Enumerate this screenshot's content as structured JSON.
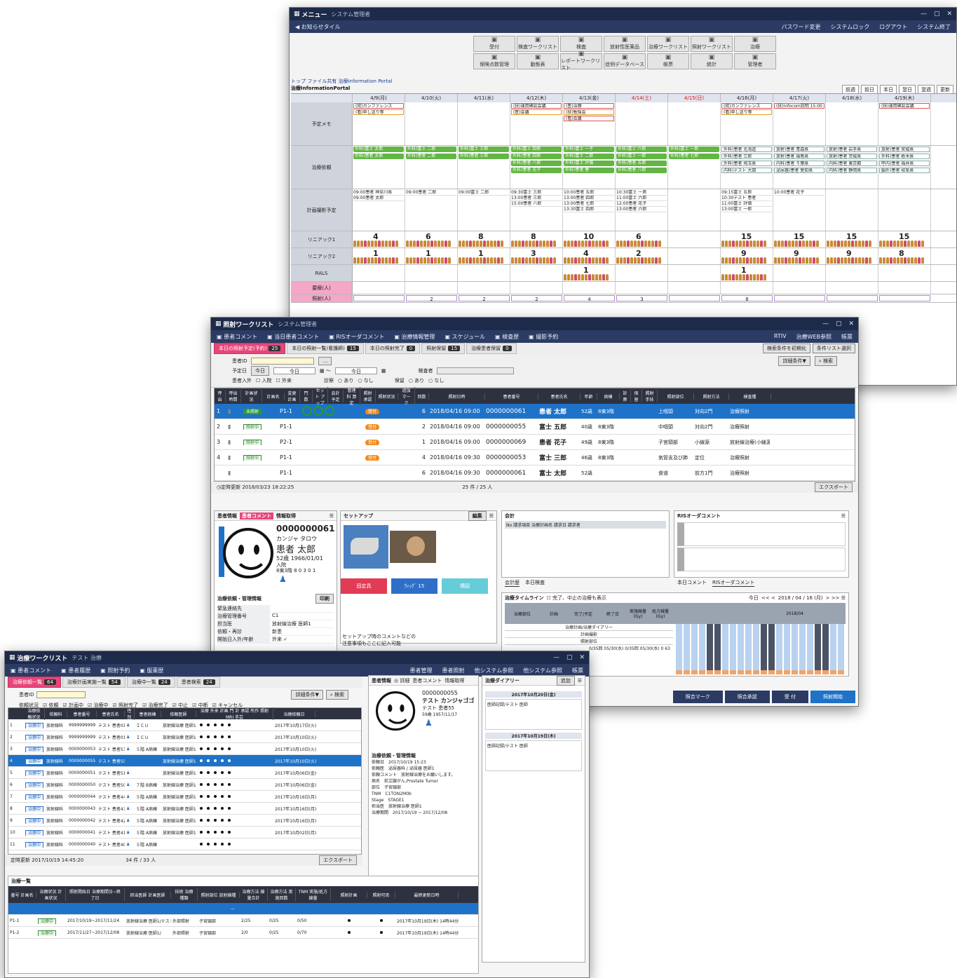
{
  "menu_window": {
    "title": "メニュー",
    "subtitle": "システム管理者",
    "toolbar_left": "お知らせタイル",
    "toolbar_right": [
      "パスワード変更",
      "システムロック",
      "ログアウト",
      "システム終了"
    ],
    "buttons_row1": [
      "受付",
      "検査ワークリスト",
      "検査",
      "放射性医薬品",
      "治療ワークリスト",
      "照射ワークリスト",
      "治療"
    ],
    "buttons_row2": [
      "保険点数管理",
      "動態表",
      "レポートワークリスト",
      "症例データベース",
      "帳票",
      "統計",
      "管理者"
    ],
    "breadcrumb": "トップ ファイル共有 治療Information Portal",
    "portal_title": "治療InformationPortal",
    "nav_buttons": [
      "前週",
      "前日",
      "本日",
      "翌日",
      "翌週",
      "更新"
    ],
    "dates": [
      "4/9(月)",
      "4/10(火)",
      "4/11(水)",
      "4/12(木)",
      "4/13(金)",
      "4/14(土)",
      "4/15(日)",
      "4/16(月)",
      "4/17(火)",
      "4/18(水)",
      "4/19(木)"
    ],
    "row_labels": {
      "memo": "予定メモ",
      "request": "治療依頼",
      "plan": "計画撮影予定",
      "linac1": "リニアック1",
      "linac2": "リニアック2",
      "rals": "RALS",
      "group": "照射人数 合計(外・入)",
      "red": "要療(人)",
      "pink": "照射(人)"
    },
    "memo_cells": [
      [
        "(院)カンファレンス",
        "(看)申し送り等"
      ],
      [],
      [],
      [
        "(技)運用確認会議",
        "(医)会議"
      ],
      [
        "(医)治療",
        "(技)勉強会",
        "(看)会議"
      ],
      [],
      [],
      [
        "(院)カンファレンス",
        "(看)申し送り等"
      ],
      [
        "(技)infocom説明 15:00"
      ],
      [],
      [
        "(技)運用確認会議"
      ]
    ],
    "request_cells": [
      [
        "外科)富士 太郎",
        "外科)患者 太郎"
      ],
      [
        "外科)富士 二郎",
        "外科)患者 二郎"
      ],
      [
        "外科)富士 三郎",
        "外科)患者 三郎"
      ],
      [
        "外科)富士 四郎",
        "外科)患者 四郎",
        "外科)患者 八郎",
        "外科)患者 花子"
      ],
      [
        "外科)富士 一子",
        "外科)富士 二郎",
        "外科)富士 評価",
        "外科)患者 春"
      ],
      [
        "外科)富士 六郎",
        "外科)富士 一郎",
        "外科)患者 五郎",
        "外科)患者 八郎"
      ],
      [
        "外科)富士 一郎",
        "外科)患者 七郎"
      ],
      [
        "外科)患者 北海道",
        "外科)患者 三郎",
        "外科)患者 埼玉県",
        "内科)テスト 大田"
      ],
      [
        "放射)患者 青森県",
        "放射)患者 福島県",
        "内科)患者 千葉県",
        "泌尿器)患者 愛知県"
      ],
      [
        "放射)患者 岩手県",
        "放射)患者 茨城県",
        "内科)患者 東京都",
        "内科)患者 静岡県"
      ],
      [
        "放射)患者 宮城県",
        "外科)患者 栃木県",
        "呼内)患者 福井県",
        "脳外)患者 岐阜県"
      ]
    ],
    "plan_cells": [
      [
        "09:00患者 神奈川県",
        "09:00患者 太郎"
      ],
      [
        "09:00患者 二郎"
      ],
      [
        "09:00富士 二郎"
      ],
      [
        "09:30富士 三郎",
        "13:00患者 三郎",
        "15:00患者 八郎"
      ],
      [
        "10:00患者 五郎",
        "13:00患者 四郎",
        "13:00患者 七郎",
        "13:30富士 四郎"
      ],
      [
        "10:30富士 一男",
        "11:00富士 六郎",
        "12:00患者 花子",
        "13:00患者 六郎"
      ],
      [],
      [
        "09:15富士 五郎",
        "10:30テスト 患者",
        "11:00富士 評価",
        "13:00富士 一郎"
      ],
      [
        "10:00患者 花子"
      ],
      [],
      []
    ],
    "linac1_nums": [
      "4",
      "6",
      "8",
      "8",
      "10",
      "6",
      "",
      "15",
      "15",
      "15",
      "15"
    ],
    "linac2_nums": [
      "1",
      "1",
      "1",
      "3",
      "4",
      "2",
      "",
      "9",
      "9",
      "9",
      "8"
    ],
    "rals_nums": [
      "",
      "",
      "",
      "",
      "1",
      "",
      "",
      "1",
      "",
      "",
      ""
    ],
    "pink_nums": [
      "",
      "2",
      "2",
      "2",
      "4",
      "3",
      "",
      "8",
      "",
      "",
      ""
    ]
  },
  "shosha_window": {
    "title": "照射ワークリスト",
    "subtitle": "システム管理者",
    "toolbar": [
      "患者コメント",
      "当日患者コメント",
      "RISオーダコメント",
      "治療情報管理",
      "スケジュール",
      "検査歴",
      "撮影予約"
    ],
    "toolbar_right": [
      "RTIV",
      "治療WEB参照",
      "帳票"
    ],
    "tabs": [
      {
        "label": "本日の照射予定(予約)",
        "count": "25"
      },
      {
        "label": "本日の照射一覧(看護師)",
        "count": "15"
      },
      {
        "label": "本日の照射完了",
        "count": "0"
      },
      {
        "label": "照射保留",
        "count": "15"
      },
      {
        "label": "治療患者保留",
        "count": "0"
      }
    ],
    "tabs_right": [
      "検索条件を初期化",
      "条件リスト選択"
    ],
    "cond": {
      "patient_id_label": "患者ID",
      "date_label": "予定日",
      "today": "今日",
      "date_from": "今日",
      "date_to": "今日",
      "checker_label": "検査者",
      "inout_label": "患者入外",
      "in": "入院",
      "out": "外来",
      "shinsatsu": "診察",
      "ari": "あり",
      "nashi": "なし",
      "horyu": "保留",
      "detail": "詳細条件▼",
      "search": "検索"
    },
    "headers": [
      "呼出",
      "呼出時間",
      "計画状況",
      "計画名",
      "変更計画",
      "門 数",
      "セット アップ",
      "会計 予定",
      "管理料 算定",
      "照射 承認",
      "照射状況",
      "追加 マーク",
      "回数",
      "照射日時",
      "患者番号",
      "患者氏名",
      "年齢",
      "病棟",
      "診察",
      "保留",
      "照射 手技",
      "照射部位",
      "照射方法",
      "検査種"
    ],
    "rows": [
      {
        "no": "1",
        "status": "未照射",
        "plan": "P1-1",
        "st": "受付",
        "count": "6",
        "datetime": "2018/04/16 09:00",
        "id": "0000000061",
        "name": "患者 太郎",
        "age": "52歳",
        "ward": "8東3階",
        "site": "上咽頭",
        "method": "対向2門",
        "type": "治療照射"
      },
      {
        "no": "2",
        "status": "照射中",
        "plan": "P1-1",
        "st": "受付",
        "count": "2",
        "datetime": "2018/04/16 09:00",
        "id": "0000000055",
        "name": "富士 五郎",
        "age": "40歳",
        "ward": "8東3階",
        "site": "中咽頭",
        "method": "対向2門",
        "type": "治療照射"
      },
      {
        "no": "3",
        "status": "照射中",
        "plan": "P2-1",
        "st": "受付",
        "count": "1",
        "datetime": "2018/04/16 09:00",
        "id": "0000000069",
        "name": "患者 花子",
        "age": "49歳",
        "ward": "8東3階",
        "site": "子宮頸部",
        "method": "小線源",
        "type": "放射線治療(小線源)"
      },
      {
        "no": "4",
        "status": "照射中",
        "plan": "P1-1",
        "st": "受付",
        "count": "4",
        "datetime": "2018/04/16 09:30",
        "id": "0000000053",
        "name": "富士 三郎",
        "age": "46歳",
        "ward": "8東3階",
        "site": "気管支及び肺",
        "method": "定位",
        "type": "治療照射"
      },
      {
        "no": "",
        "status": "",
        "plan": "P1-1",
        "st": "",
        "count": "6",
        "datetime": "2018/04/16 09:30",
        "id": "0000000061",
        "name": "富士 太郎",
        "age": "52歳",
        "ward": "",
        "site": "食道",
        "method": "前方1門",
        "type": "治療照射"
      }
    ],
    "status_time": "定時更新 2018/03/23 18:22:25",
    "count": "25 件 / 25 人",
    "export": "エクスポート",
    "patient_panel": {
      "title": "患者情報",
      "tab1": "患者コメント",
      "tab2": "情報取得",
      "id": "0000000061",
      "kana": "カンジャ タロウ",
      "name": "患者 太郎",
      "birth": "52歳 1966/01/01",
      "ward": "入院",
      "room": "8東3階 8 0 3 0 1"
    },
    "setup_panel": {
      "title": "セットアップ",
      "edit": "編集",
      "btn1": "固定具",
      "btn2": "ｳｨｯｸﾞ 15",
      "btn3": "構図",
      "note1": "セットアップ時のコメントなどの",
      "note2": "注意事項もここに記入可能"
    },
    "account_panel": {
      "title": "会計",
      "head": "No 請求項目 治療計画名 請求日 請求者",
      "tab1": "会計歴",
      "tab2": "本日検査"
    },
    "ris_panel": {
      "title": "RISオーダコメント",
      "tab1": "本日コメント",
      "tab2": "RISオーダコメント"
    },
    "timeline": {
      "title": "治療タイムライン",
      "check": "完了、中止の治療も表示",
      "today": "今日",
      "date": "2018 / 04 / 16 (月)",
      "month": "2018/04",
      "cols": [
        "治療部位",
        "計画",
        "完了/予定",
        "終了日",
        "実施線量 (Gy)",
        "処方線量 (Gy)"
      ],
      "rows": [
        "治療計画/治療ダイアリー",
        "計画撮影",
        "照射部位"
      ],
      "vals": [
        "0/35回",
        "05/30(水)",
        "0/35回",
        "05/30(水)",
        "0",
        "63"
      ]
    },
    "management": {
      "title": "治療依頼・管理情報",
      "print": "印刷",
      "labels": [
        "緊急連絡先",
        "治療管理番号",
        "担当医",
        "依頼・再診",
        "開始日入外/年齢"
      ],
      "values": [
        "",
        "C1",
        "放射線治療 医師1",
        "新患",
        "外来 ✓"
      ]
    },
    "footer": [
      "照合マーク",
      "照合承認",
      "受 付",
      "照射開始"
    ]
  },
  "chiryo_window": {
    "title": "治療ワークリスト",
    "subtitle": "テスト 治療",
    "toolbar": [
      "患者コメント",
      "患者履歴",
      "照射予約",
      "服薬歴"
    ],
    "toolbar_right": [
      "患者管理",
      "患者照射",
      "他システム参照",
      "他システム参照",
      "帳票"
    ],
    "tabs": [
      {
        "label": "治療依頼一覧",
        "count": "64"
      },
      {
        "label": "治療計画実施一覧",
        "count": "54"
      },
      {
        "label": "治療中一覧",
        "count": "24"
      },
      {
        "label": "患者検索",
        "count": "24"
      }
    ],
    "filters": [
      "依頼状況",
      "依頼",
      "計画中",
      "治療中",
      "照射完了",
      "治療完了",
      "中止",
      "中断",
      "キャンセル"
    ],
    "rows": [
      {
        "no": "1",
        "id": "9999999999",
        "name": "テスト 患者01",
        "ward": "ＩＣＵ",
        "doc": "放射線治療 医師1",
        "date": "2017年10月17日(火)"
      },
      {
        "no": "2",
        "id": "9999999999",
        "name": "テスト 患者01",
        "ward": "ＩＣＵ",
        "doc": "放射線治療 医師1",
        "date": "2017年10月10日(火)"
      },
      {
        "no": "3",
        "id": "0000000053",
        "name": "テスト 患者53",
        "ward": "５階 A病棟",
        "doc": "放射線治療 医師1",
        "date": "2017年10月10日(火)"
      },
      {
        "no": "4",
        "id": "0000000055",
        "name": "テスト 患者55",
        "ward": "",
        "doc": "放射線治療 医師1",
        "date": "2017年10月10日(火)"
      },
      {
        "no": "5",
        "id": "0000000051",
        "name": "テスト 患者51",
        "ward": "",
        "doc": "放射線治療 医師1",
        "date": "2017年10月06日(金)"
      },
      {
        "no": "6",
        "id": "0000000050",
        "name": "テスト 患者50",
        "ward": "７階 B病棟",
        "doc": "放射線治療 医師1",
        "date": "2017年10月06日(金)"
      },
      {
        "no": "7",
        "id": "0000000044",
        "name": "テスト 患者44",
        "ward": "５階 A病棟",
        "doc": "放射線治療 医師1",
        "date": "2017年10月16日(月)"
      },
      {
        "no": "8",
        "id": "0000000043",
        "name": "テスト 患者43",
        "ward": "５階 A病棟",
        "doc": "放射線治療 医師1",
        "date": "2017年10月16日(月)"
      },
      {
        "no": "9",
        "id": "0000000042",
        "name": "テスト 患者42",
        "ward": "５階 A病棟",
        "doc": "放射線治療 医師1",
        "date": "2017年10月16日(月)"
      },
      {
        "no": "10",
        "id": "0000000041",
        "name": "テスト 患者41",
        "ward": "５階 A病棟",
        "doc": "放射線治療 医師1",
        "date": "2017年10月02日(月)"
      },
      {
        "no": "11",
        "id": "0000000040",
        "name": "テスト 患者40",
        "ward": "５階 A病棟",
        "doc": "",
        "date": ""
      }
    ],
    "status_time": "定時更新 2017/10/19 14:45:20",
    "count": "34 件 / 33 人",
    "export": "エクスポート",
    "patient": {
      "id": "0000000055",
      "kana": "テスト カンジャゴゴ",
      "name": "テスト 患者55",
      "birth": "59歳 1957/11/17"
    },
    "diary_title": "治療ダイアリー",
    "diary_dates": [
      "2017年10月20日(金)",
      "2017年10月19日(木)"
    ],
    "list_title": "治療一覧",
    "list_rows": [
      {
        "plan": "P1-1",
        "period": "2017/10/19~2017/11/24",
        "doc": "放射線治療 医師1/テスト 治療",
        "dept": "外部照射",
        "site": "子宮頸部",
        "a": "2/25",
        "b": "0/25",
        "c": "0/50",
        "updated": "2017年10月19日(木) 14時44分"
      },
      {
        "plan": "P1-2",
        "period": "2017/11/27~2017/12/08",
        "doc": "放射線治療 医師1/",
        "dept": "外部照射",
        "site": "子宮頸部",
        "a": "2/0",
        "b": "0/25",
        "c": "0/70",
        "updated": "2017年10月19日(木) 14時44分"
      }
    ]
  }
}
